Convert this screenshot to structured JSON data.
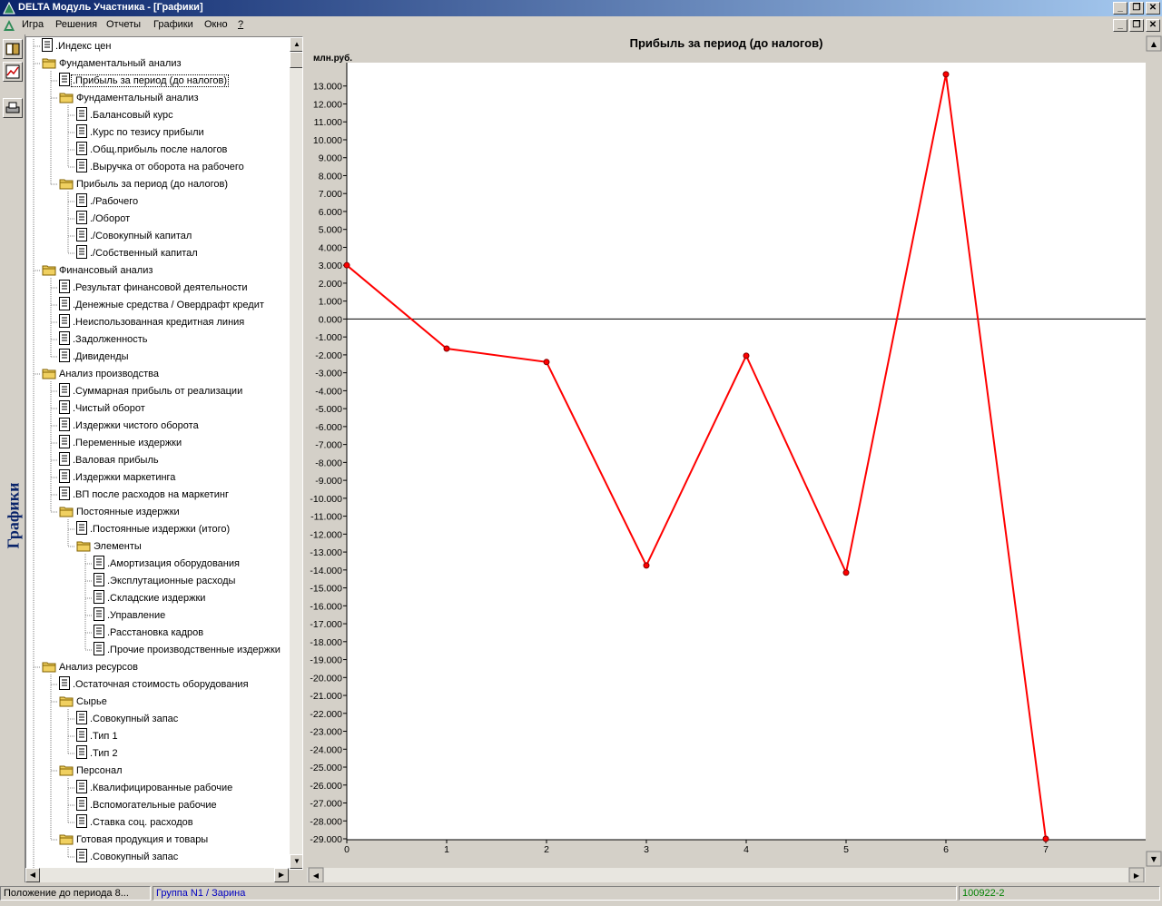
{
  "window": {
    "title": "DELTA Модуль Участника - [Графики]",
    "controls": {
      "minimize": "_",
      "restore": "❐",
      "close": "✕"
    }
  },
  "menu": [
    "Игра",
    "Решения",
    "Отчеты",
    "Графики",
    "Окно",
    "?"
  ],
  "side_label": "Графики",
  "tree": [
    {
      "label": ".Индекс цен",
      "level": 0,
      "type": "doc"
    },
    {
      "label": "Фундаментальный анализ",
      "level": 0,
      "type": "folder"
    },
    {
      "label": ".Прибыль за период (до налогов)",
      "level": 1,
      "type": "doc",
      "selected": true
    },
    {
      "label": "Фундаментальный анализ",
      "level": 1,
      "type": "folder"
    },
    {
      "label": ".Балансовый курс",
      "level": 2,
      "type": "doc"
    },
    {
      "label": ".Курс по тезису прибыли",
      "level": 2,
      "type": "doc"
    },
    {
      "label": ".Общ.прибыль после налогов",
      "level": 2,
      "type": "doc"
    },
    {
      "label": ".Выручка от оборота на рабочего",
      "level": 2,
      "type": "doc"
    },
    {
      "label": "Прибыль за период (до налогов)",
      "level": 1,
      "type": "folder"
    },
    {
      "label": "./Рабочего",
      "level": 2,
      "type": "doc"
    },
    {
      "label": "./Оборот",
      "level": 2,
      "type": "doc"
    },
    {
      "label": "./Совокупный капитал",
      "level": 2,
      "type": "doc"
    },
    {
      "label": "./Собственный капитал",
      "level": 2,
      "type": "doc"
    },
    {
      "label": "Финансовый анализ",
      "level": 0,
      "type": "folder"
    },
    {
      "label": ".Результат финансовой деятельности",
      "level": 1,
      "type": "doc"
    },
    {
      "label": ".Денежные средства / Овердрафт кредит",
      "level": 1,
      "type": "doc"
    },
    {
      "label": ".Неиспользованная кредитная линия",
      "level": 1,
      "type": "doc"
    },
    {
      "label": ".Задолженность",
      "level": 1,
      "type": "doc"
    },
    {
      "label": ".Дивиденды",
      "level": 1,
      "type": "doc"
    },
    {
      "label": "Анализ производства",
      "level": 0,
      "type": "folder"
    },
    {
      "label": ".Суммарная прибыль от реализации",
      "level": 1,
      "type": "doc"
    },
    {
      "label": ".Чистый оборот",
      "level": 1,
      "type": "doc"
    },
    {
      "label": ".Издержки чистого оборота",
      "level": 1,
      "type": "doc"
    },
    {
      "label": ".Переменные издержки",
      "level": 1,
      "type": "doc"
    },
    {
      "label": ".Валовая прибыль",
      "level": 1,
      "type": "doc"
    },
    {
      "label": ".Издержки маркетинга",
      "level": 1,
      "type": "doc"
    },
    {
      "label": ".ВП после расходов на маркетинг",
      "level": 1,
      "type": "doc"
    },
    {
      "label": "Постоянные издержки",
      "level": 1,
      "type": "folder"
    },
    {
      "label": ".Постоянные издержки (итого)",
      "level": 2,
      "type": "doc"
    },
    {
      "label": "Элементы",
      "level": 2,
      "type": "folder"
    },
    {
      "label": ".Амортизация оборудования",
      "level": 3,
      "type": "doc"
    },
    {
      "label": ".Эксплутационные расходы",
      "level": 3,
      "type": "doc"
    },
    {
      "label": ".Складские издержки",
      "level": 3,
      "type": "doc"
    },
    {
      "label": ".Управление",
      "level": 3,
      "type": "doc"
    },
    {
      "label": ".Расстановка кадров",
      "level": 3,
      "type": "doc"
    },
    {
      "label": ".Прочие производственные издержки",
      "level": 3,
      "type": "doc"
    },
    {
      "label": "Анализ ресурсов",
      "level": 0,
      "type": "folder"
    },
    {
      "label": ".Остаточная стоимость оборудования",
      "level": 1,
      "type": "doc"
    },
    {
      "label": "Сырье",
      "level": 1,
      "type": "folder"
    },
    {
      "label": ".Совокупный запас",
      "level": 2,
      "type": "doc"
    },
    {
      "label": ".Тип 1",
      "level": 2,
      "type": "doc"
    },
    {
      "label": ".Тип 2",
      "level": 2,
      "type": "doc"
    },
    {
      "label": "Персонал",
      "level": 1,
      "type": "folder"
    },
    {
      "label": ".Квалифицированные рабочие",
      "level": 2,
      "type": "doc"
    },
    {
      "label": ".Вспомогательные рабочие",
      "level": 2,
      "type": "doc"
    },
    {
      "label": ".Ставка соц. расходов",
      "level": 2,
      "type": "doc"
    },
    {
      "label": "Готовая продукция и товары",
      "level": 1,
      "type": "folder"
    },
    {
      "label": ".Совокупный запас",
      "level": 2,
      "type": "doc"
    }
  ],
  "chart_data": {
    "type": "line",
    "title": "Прибыль за период (до налогов)",
    "ylabel": "млн.руб.",
    "xlabel": "",
    "x": [
      0,
      1,
      2,
      3,
      4,
      5,
      6,
      7
    ],
    "series": [
      {
        "values": [
          3.0,
          -1.65,
          -2.4,
          -13.75,
          -2.05,
          -14.15,
          13.65,
          -29.0
        ]
      }
    ],
    "ylim": [
      -29,
      14
    ],
    "xlim": [
      0,
      8
    ],
    "yticks": [
      13,
      12,
      11,
      10,
      9,
      8,
      7,
      6,
      5,
      4,
      3,
      2,
      1,
      0,
      -1,
      -2,
      -3,
      -4,
      -5,
      -6,
      -7,
      -8,
      -9,
      -10,
      -11,
      -12,
      -13,
      -14,
      -15,
      -16,
      -17,
      -18,
      -19,
      -20,
      -21,
      -22,
      -23,
      -24,
      -25,
      -26,
      -27,
      -28,
      -29
    ],
    "line_color": "#ff0000",
    "grid": false,
    "legend": "none"
  },
  "status": {
    "left": "Положение до периода 8...",
    "group": "Группа N1 / Зарина",
    "code": "100922-2"
  },
  "colors": {
    "group_text": "#0000c0",
    "code_text": "#008000",
    "chart_line": "#ff0000"
  },
  "icons": [
    "book-icon",
    "chart-icon",
    "printer-icon",
    "delta-logo-icon",
    "folder-icon",
    "document-icon"
  ]
}
